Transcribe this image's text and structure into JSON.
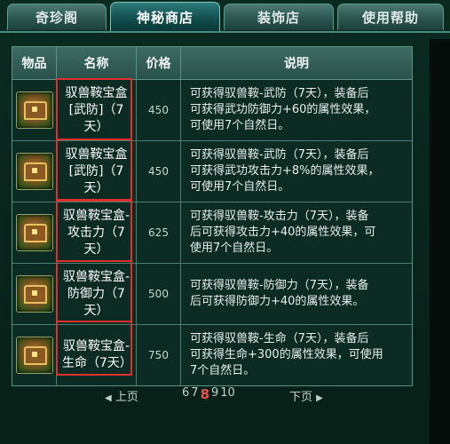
{
  "tabs": [
    {
      "label": "奇珍阁"
    },
    {
      "label": "神秘商店"
    },
    {
      "label": "装饰店"
    },
    {
      "label": "使用帮助"
    }
  ],
  "table": {
    "headers": [
      "物品",
      "名称",
      "价格",
      "说明"
    ],
    "rows": [
      {
        "name": "驭兽鞍宝盒[武防]（7天）",
        "price": "450",
        "desc": "可获得驭兽鞍-武防（7天），装备后可获得武功防御力+60的属性效果，可使用7个自然日。"
      },
      {
        "name": "驭兽鞍宝盒[武防]（7天）",
        "price": "450",
        "desc": "可获得驭兽鞍-武防（7天），装备后可获得武功攻击力+8%的属性效果，可使用7个自然日。"
      },
      {
        "name": "驭兽鞍宝盒-攻击力（7天）",
        "price": "625",
        "desc": "可获得驭兽鞍-攻击力（7天），装备后可获得攻击力+40的属性效果，可使用7个自然日。"
      },
      {
        "name": "驭兽鞍宝盒-防御力（7天）",
        "price": "500",
        "desc": "可获得驭兽鞍-防御力（7天），装备后可获得防御力+40的属性效果。"
      },
      {
        "name": "驭兽鞍宝盒-生命（7天）",
        "price": "750",
        "desc": "可获得驭兽鞍-生命（7天），装备后可获得生命+300的属性效果，可使用7个自然日。"
      }
    ]
  },
  "rows_display": [
    {
      "name_lines": [
        "驭兽鞍宝盒",
        "[武防]（7",
        "天）"
      ],
      "desc_lines": [
        "可获得驭兽鞍-武防（7天），装备后",
        "可获得武功防御力+60的属性效果，",
        "可使用7个自然日。"
      ]
    },
    {
      "name_lines": [
        "驭兽鞍宝盒",
        "[武防]（7",
        "天）"
      ],
      "desc_lines": [
        "可获得驭兽鞍-武防（7天），装备后",
        "可获得武功攻击力+8%的属性效果，",
        "可使用7个自然日。"
      ]
    },
    {
      "name_lines": [
        "驭兽鞍宝盒-",
        "攻击力（7",
        "天）"
      ],
      "desc_lines": [
        "可获得驭兽鞍-攻击力（7天），装备",
        "后可获得攻击力+40的属性效果，可",
        "使用7个自然日。"
      ]
    },
    {
      "name_lines": [
        "驭兽鞍宝盒-",
        "防御力（7",
        "天）"
      ],
      "desc_lines": [
        "可获得驭兽鞍-防御力（7天），装备",
        "后可获得防御力+40的属性效果。"
      ]
    },
    {
      "name_lines": [
        "驭兽鞍宝盒-",
        "生命（7天）"
      ],
      "desc_lines": [
        "可获得驭兽鞍-生命（7天），装备后",
        "可获得生命+300的属性效果，可使用",
        "7个自然日。"
      ]
    }
  ],
  "pager": {
    "prev_label": "上页",
    "next_label": "下页",
    "pages": [
      "6",
      "7",
      "8",
      "9",
      "10"
    ],
    "current": "8"
  },
  "colors": {
    "accent": "#e0302e",
    "current_page": "#e8534a"
  }
}
